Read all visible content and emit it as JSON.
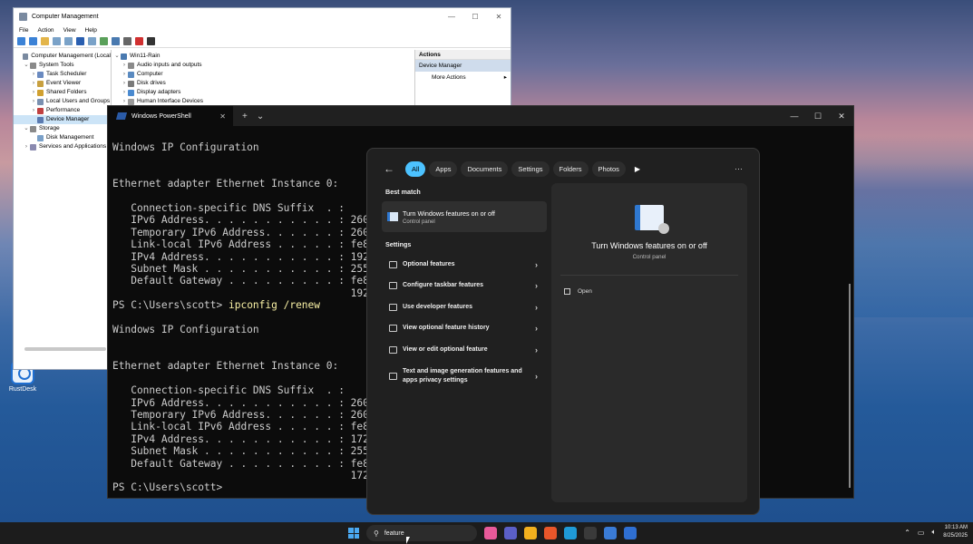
{
  "desktop": {
    "icons": [
      {
        "label": "RustDesk"
      }
    ]
  },
  "computer_management": {
    "title": "Computer Management",
    "menu": [
      "File",
      "Action",
      "View",
      "Help"
    ],
    "tree": [
      {
        "label": "Computer Management (Local",
        "indent": 0,
        "expand": ""
      },
      {
        "label": "System Tools",
        "indent": 1,
        "expand": "⌄"
      },
      {
        "label": "Task Scheduler",
        "indent": 2,
        "expand": "›"
      },
      {
        "label": "Event Viewer",
        "indent": 2,
        "expand": "›"
      },
      {
        "label": "Shared Folders",
        "indent": 2,
        "expand": "›"
      },
      {
        "label": "Local Users and Groups",
        "indent": 2,
        "expand": "›"
      },
      {
        "label": "Performance",
        "indent": 2,
        "expand": "›"
      },
      {
        "label": "Device Manager",
        "indent": 2,
        "expand": "",
        "selected": true
      },
      {
        "label": "Storage",
        "indent": 1,
        "expand": "⌄"
      },
      {
        "label": "Disk Management",
        "indent": 2,
        "expand": ""
      },
      {
        "label": "Services and Applications",
        "indent": 1,
        "expand": "›"
      }
    ],
    "devices": [
      {
        "label": "Win11-Rain",
        "expand": "⌄"
      },
      {
        "label": "Audio inputs and outputs",
        "expand": "›"
      },
      {
        "label": "Computer",
        "expand": "›"
      },
      {
        "label": "Disk drives",
        "expand": "›"
      },
      {
        "label": "Display adapters",
        "expand": "›"
      },
      {
        "label": "Human Interface Devices",
        "expand": "›"
      }
    ],
    "actions": {
      "header": "Actions",
      "selected": "Device Manager",
      "more": "More Actions"
    }
  },
  "powershell": {
    "tab_title": "Windows PowerShell",
    "prompt": "PS C:\\Users\\scott> ",
    "command": "ipconfig /renew",
    "block1": "Windows IP Configuration\n\n\nEthernet adapter Ethernet Instance 0:\n\n   Connection-specific DNS Suffix  . :\n   IPv6 Address. . . . . . . . . . . : 260\n   Temporary IPv6 Address. . . . . . : 260\n   Link-local IPv6 Address . . . . . : fe8\n   IPv4 Address. . . . . . . . . . . : 192\n   Subnet Mask . . . . . . . . . . . : 255\n   Default Gateway . . . . . . . . . : fe8\n                                       192\n",
    "block2": "\nWindows IP Configuration\n\n\nEthernet adapter Ethernet Instance 0:\n\n   Connection-specific DNS Suffix  . :\n   IPv6 Address. . . . . . . . . . . : 260\n   Temporary IPv6 Address. . . . . . : 260\n   Link-local IPv6 Address . . . . . : fe8\n   IPv4 Address. . . . . . . . . . . : 172\n   Subnet Mask . . . . . . . . . . . : 255\n   Default Gateway . . . . . . . . . : fe8\n                                       172\n",
    "final_prompt": "PS C:\\Users\\scott>"
  },
  "search_panel": {
    "filters": [
      "All",
      "Apps",
      "Documents",
      "Settings",
      "Folders",
      "Photos"
    ],
    "active_filter": "All",
    "best_match_header": "Best match",
    "best_match": {
      "title": "Turn Windows features on or off",
      "subtitle": "Control panel"
    },
    "settings_header": "Settings",
    "settings": [
      "Optional features",
      "Configure taskbar features",
      "Use developer features",
      "View optional feature history",
      "View or edit optional feature",
      "Text and image generation features and apps privacy settings"
    ],
    "preview": {
      "title": "Turn Windows features on or off",
      "subtitle": "Control panel",
      "open": "Open"
    }
  },
  "taskbar": {
    "search_query": "feature",
    "time": "10:13 AM",
    "date": "8/25/2025",
    "app_colors": [
      "#e85a9a",
      "#5b5fc7",
      "#f2b01e",
      "#e8562a",
      "#1f9ad6",
      "#3a3a3a",
      "#3a7bd5",
      "#2f6fd1"
    ]
  }
}
